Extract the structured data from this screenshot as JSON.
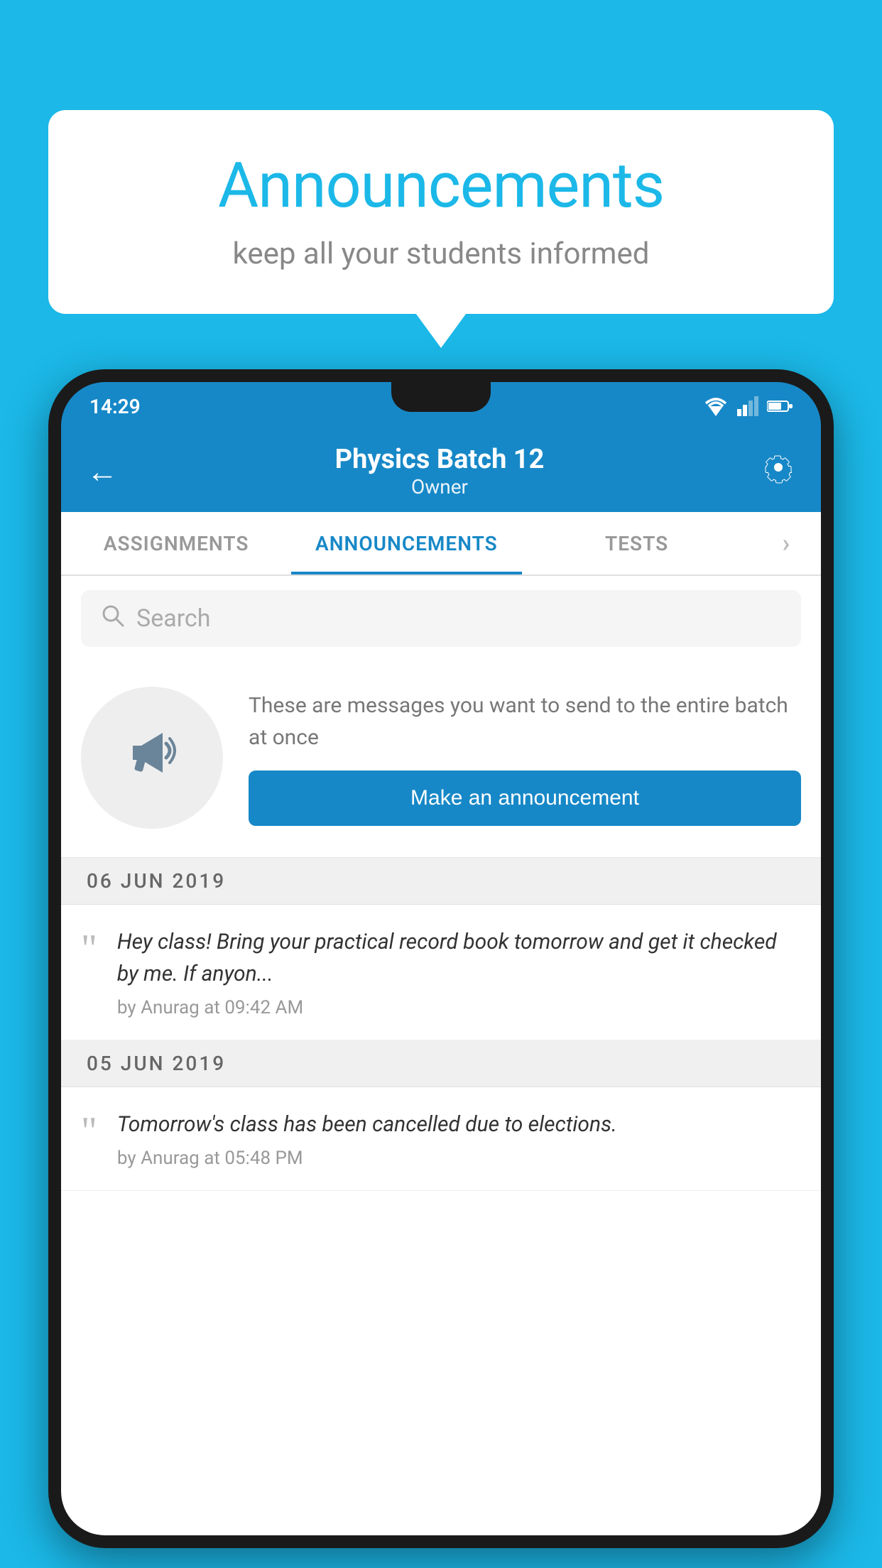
{
  "background": {
    "color": "#1BB8E8"
  },
  "speech_bubble": {
    "title": "Announcements",
    "subtitle": "keep all your students informed"
  },
  "phone": {
    "status_bar": {
      "time": "14:29"
    },
    "app_bar": {
      "title": "Physics Batch 12",
      "subtitle": "Owner",
      "back_label": "←",
      "settings_label": "⚙"
    },
    "tabs": [
      {
        "label": "ASSIGNMENTS",
        "active": false
      },
      {
        "label": "ANNOUNCEMENTS",
        "active": true
      },
      {
        "label": "TESTS",
        "active": false
      },
      {
        "label": "›",
        "active": false
      }
    ],
    "search": {
      "placeholder": "Search"
    },
    "announcement_prompt": {
      "description": "These are messages you want to send to the entire batch at once",
      "button_label": "Make an announcement"
    },
    "announcements": [
      {
        "date": "06  JUN  2019",
        "message": "Hey class! Bring your practical record book tomorrow and get it checked by me. If anyon...",
        "meta": "by Anurag at 09:42 AM"
      },
      {
        "date": "05  JUN  2019",
        "message": "Tomorrow's class has been cancelled due to elections.",
        "meta": "by Anurag at 05:48 PM"
      }
    ]
  }
}
